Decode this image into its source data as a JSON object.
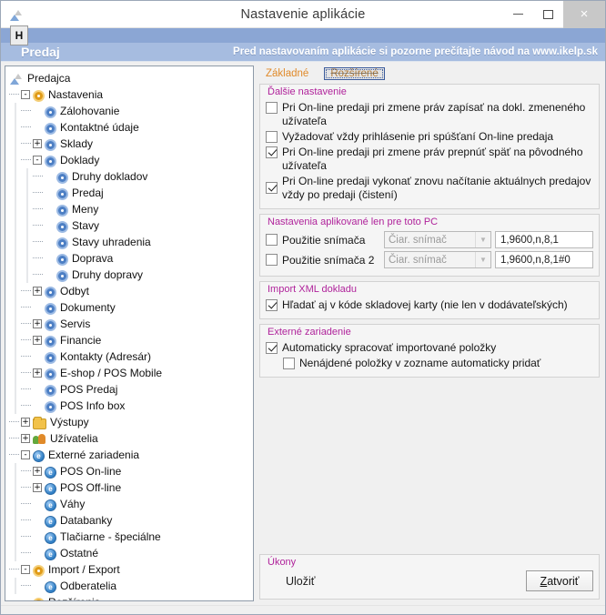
{
  "window": {
    "title": "Nastavenie aplikácie",
    "app_icon": "app-logo-icon",
    "minimize_label": "−",
    "maximize_label": "□",
    "close_label": "×"
  },
  "menubar": {
    "menu_label": "H"
  },
  "banner": {
    "title": "Predaj",
    "note": "Pred nastavovaním aplikácie si pozorne prečítajte návod na www.ikelp.sk"
  },
  "tree": {
    "nodes": [
      {
        "label": "Predajca",
        "depth": 0,
        "icon": "app-logo-icon",
        "expander": ""
      },
      {
        "label": "Nastavenia",
        "depth": 1,
        "icon": "gear-orange-icon",
        "expander": "-"
      },
      {
        "label": "Zálohovanie",
        "depth": 2,
        "icon": "gear-blue-icon",
        "expander": ""
      },
      {
        "label": "Kontaktné údaje",
        "depth": 2,
        "icon": "gear-blue-icon",
        "expander": ""
      },
      {
        "label": "Sklady",
        "depth": 2,
        "icon": "gear-blue-icon",
        "expander": "+"
      },
      {
        "label": "Doklady",
        "depth": 2,
        "icon": "gear-blue-icon",
        "expander": "-"
      },
      {
        "label": "Druhy dokladov",
        "depth": 3,
        "icon": "gear-blue-icon",
        "expander": ""
      },
      {
        "label": "Predaj",
        "depth": 3,
        "icon": "gear-blue-icon",
        "expander": ""
      },
      {
        "label": "Meny",
        "depth": 3,
        "icon": "gear-blue-icon",
        "expander": ""
      },
      {
        "label": "Stavy",
        "depth": 3,
        "icon": "gear-blue-icon",
        "expander": ""
      },
      {
        "label": "Stavy uhradenia",
        "depth": 3,
        "icon": "gear-blue-icon",
        "expander": ""
      },
      {
        "label": "Doprava",
        "depth": 3,
        "icon": "gear-blue-icon",
        "expander": ""
      },
      {
        "label": "Druhy dopravy",
        "depth": 3,
        "icon": "gear-blue-icon",
        "expander": ""
      },
      {
        "label": "Odbyt",
        "depth": 2,
        "icon": "gear-blue-icon",
        "expander": "+"
      },
      {
        "label": "Dokumenty",
        "depth": 2,
        "icon": "gear-blue-icon",
        "expander": ""
      },
      {
        "label": "Servis",
        "depth": 2,
        "icon": "gear-blue-icon",
        "expander": "+"
      },
      {
        "label": "Financie",
        "depth": 2,
        "icon": "gear-blue-icon",
        "expander": "+"
      },
      {
        "label": "Kontakty (Adresár)",
        "depth": 2,
        "icon": "gear-blue-icon",
        "expander": ""
      },
      {
        "label": "E-shop / POS Mobile",
        "depth": 2,
        "icon": "gear-blue-icon",
        "expander": "+"
      },
      {
        "label": "POS Predaj",
        "depth": 2,
        "icon": "gear-blue-icon",
        "expander": ""
      },
      {
        "label": "POS Info box",
        "depth": 2,
        "icon": "gear-blue-icon",
        "expander": ""
      },
      {
        "label": "Výstupy",
        "depth": 1,
        "icon": "folder-icon",
        "expander": "+"
      },
      {
        "label": "Užívatelia",
        "depth": 1,
        "icon": "users-icon",
        "expander": "+"
      },
      {
        "label": "Externé zariadenia",
        "depth": 1,
        "icon": "device-icon",
        "expander": "-"
      },
      {
        "label": "POS On-line",
        "depth": 2,
        "icon": "device-icon",
        "expander": "+"
      },
      {
        "label": "POS Off-line",
        "depth": 2,
        "icon": "device-icon",
        "expander": "+"
      },
      {
        "label": "Váhy",
        "depth": 2,
        "icon": "device-icon",
        "expander": ""
      },
      {
        "label": "Databanky",
        "depth": 2,
        "icon": "device-icon",
        "expander": ""
      },
      {
        "label": "Tlačiarne - špeciálne",
        "depth": 2,
        "icon": "device-icon",
        "expander": ""
      },
      {
        "label": "Ostatné",
        "depth": 2,
        "icon": "device-icon",
        "expander": ""
      },
      {
        "label": "Import / Export",
        "depth": 1,
        "icon": "gear-orange-icon",
        "expander": "-"
      },
      {
        "label": "Odberatelia",
        "depth": 2,
        "icon": "device-icon",
        "expander": ""
      },
      {
        "label": "Rozšírenia",
        "depth": 1,
        "icon": "gear-orange-icon",
        "expander": ""
      }
    ]
  },
  "tabs": [
    {
      "label": "Základné",
      "selected": false
    },
    {
      "label": "Rozšírené",
      "selected": true
    }
  ],
  "further_settings": {
    "title": "Ďalšie nastavenie",
    "options": [
      {
        "label": "Pri On-line predaji pri zmene práv zapísať na dokl. zmeneného užívateľa",
        "checked": false
      },
      {
        "label": "Vyžadovať vždy prihlásenie pri spúšťaní On-line predaja",
        "checked": false
      },
      {
        "label": "Pri On-line predaji pri zmene práv prepnúť späť na pôvodného užívateľa",
        "checked": true
      },
      {
        "label": "Pri On-line predaji vykonať znovu načítanie aktuálnych predajov vždy po predaji (čistení)",
        "checked": true
      }
    ]
  },
  "local_pc_settings": {
    "title": "Nastavenia aplikované len pre toto PC",
    "rows": [
      {
        "label": "Použitie snímača",
        "checked": false,
        "device": "Čiar. snímač",
        "params": "1,9600,n,8,1"
      },
      {
        "label": "Použitie snímača 2",
        "checked": false,
        "device": "Čiar. snímač",
        "params": "1,9600,n,8,1#0"
      }
    ]
  },
  "xml_import": {
    "title": "Import XML dokladu",
    "options": [
      {
        "label": "Hľadať aj v kóde skladovej karty (nie len v dodávateľských)",
        "checked": true
      }
    ]
  },
  "external_device": {
    "title": "Externé zariadenie",
    "options": [
      {
        "label": "Automaticky spracovať importované položky",
        "checked": true,
        "indent": 0
      },
      {
        "label": "Nenájdené položky v zozname automaticky pridať",
        "checked": false,
        "indent": 1
      }
    ]
  },
  "actions": {
    "title": "Úkony",
    "save_label": "Uložiť",
    "close_button": {
      "accesskey": "Z",
      "rest": "atvoriť"
    }
  },
  "colors": {
    "banner_bg": "#a6bce0",
    "menubar_bg": "#8ba6d4",
    "group_title": "#b0239b",
    "tab_accent": "#e08a2a",
    "gear_blue": "#4d7fc4",
    "gear_orange": "#e09b18"
  }
}
